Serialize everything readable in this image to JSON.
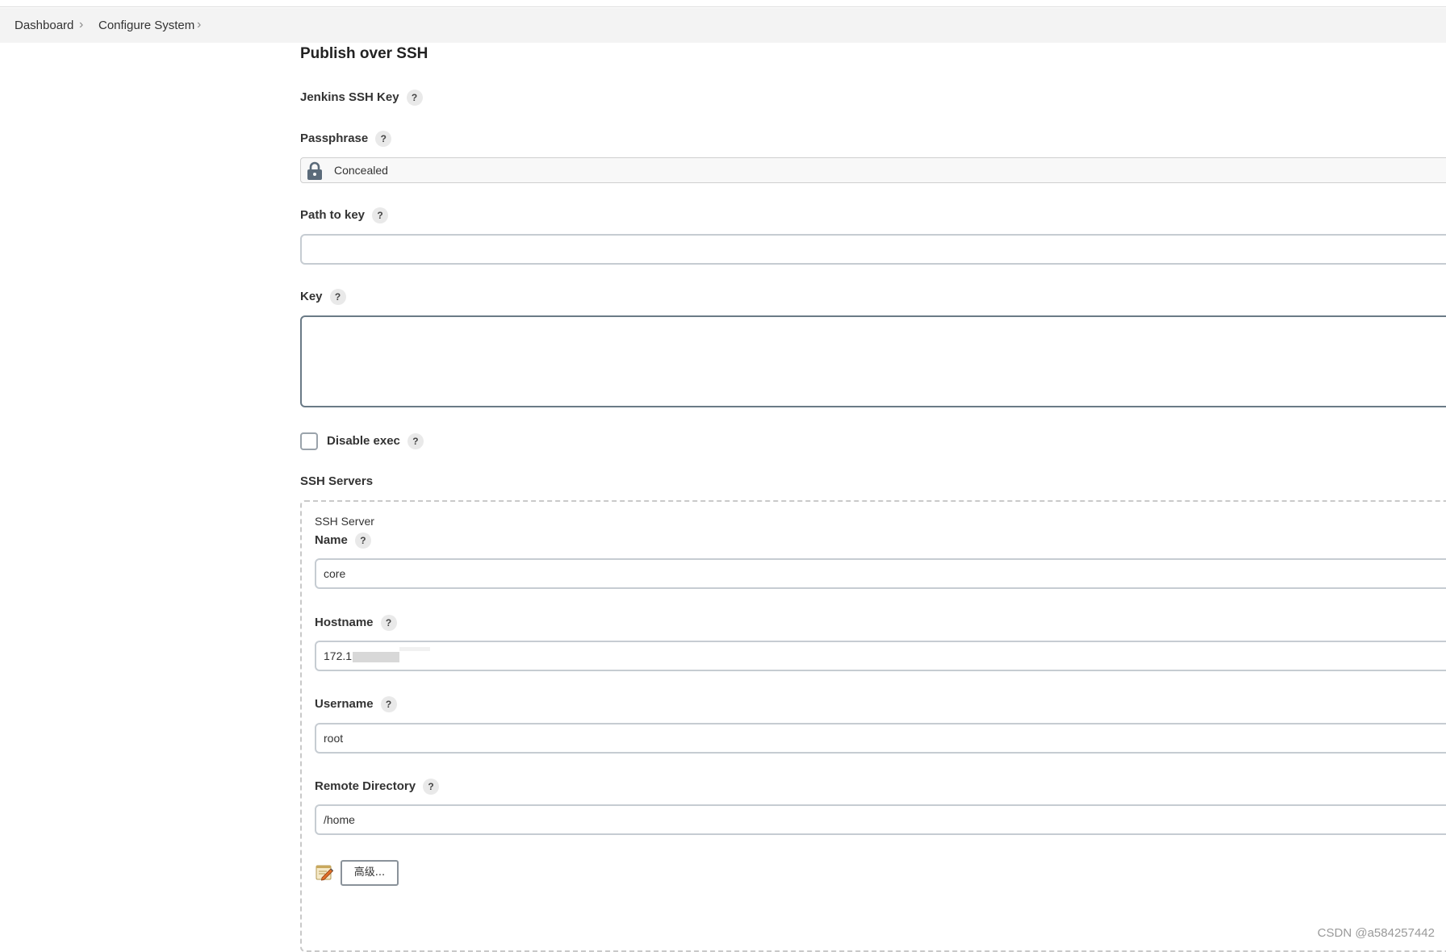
{
  "breadcrumb": {
    "items": [
      "Dashboard",
      "Configure System"
    ],
    "separator": "›"
  },
  "section": {
    "title": "Publish over SSH"
  },
  "jenkins_ssh_key": {
    "label": "Jenkins SSH Key",
    "help": "?"
  },
  "passphrase": {
    "label": "Passphrase",
    "help": "?",
    "value": "Concealed",
    "icon": "lock-icon"
  },
  "path_to_key": {
    "label": "Path to key",
    "help": "?",
    "value": ""
  },
  "key": {
    "label": "Key",
    "help": "?",
    "value": ""
  },
  "disable_exec": {
    "label": "Disable exec",
    "help": "?",
    "checked": false
  },
  "ssh_servers": {
    "label": "SSH Servers",
    "server": {
      "header": "SSH Server",
      "name": {
        "label": "Name",
        "help": "?",
        "value": "core"
      },
      "hostname": {
        "label": "Hostname",
        "help": "?",
        "value": "172.1"
      },
      "username": {
        "label": "Username",
        "help": "?",
        "value": "root"
      },
      "remote_directory": {
        "label": "Remote Directory",
        "help": "?",
        "value": "/home"
      },
      "advanced_button": "高级...",
      "edit_icon": "notepad-pencil-icon"
    }
  },
  "watermark": "CSDN @a584257442",
  "colors": {
    "breadcrumb_bg": "#f3f3f3",
    "input_border": "#c6ccd2",
    "textarea_border": "#6a7a86",
    "dashed_border": "#c9c9c9"
  }
}
